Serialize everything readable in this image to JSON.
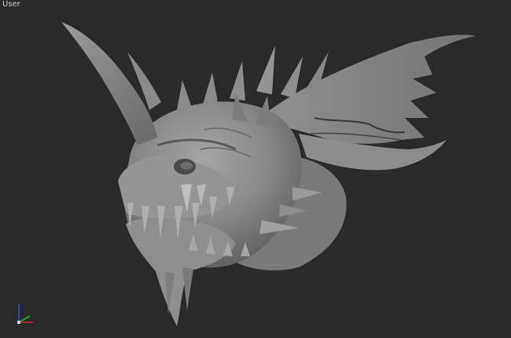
{
  "viewport": {
    "label": "User",
    "background": "#2a2a2a"
  },
  "model": {
    "subject": "dragon-head-sculpt",
    "shading": "matte-clay",
    "base_color": "#8a8a8a"
  },
  "axis_gizmo": {
    "colors": {
      "x": "#d03030",
      "y": "#30c030",
      "z": "#3050e0"
    }
  }
}
